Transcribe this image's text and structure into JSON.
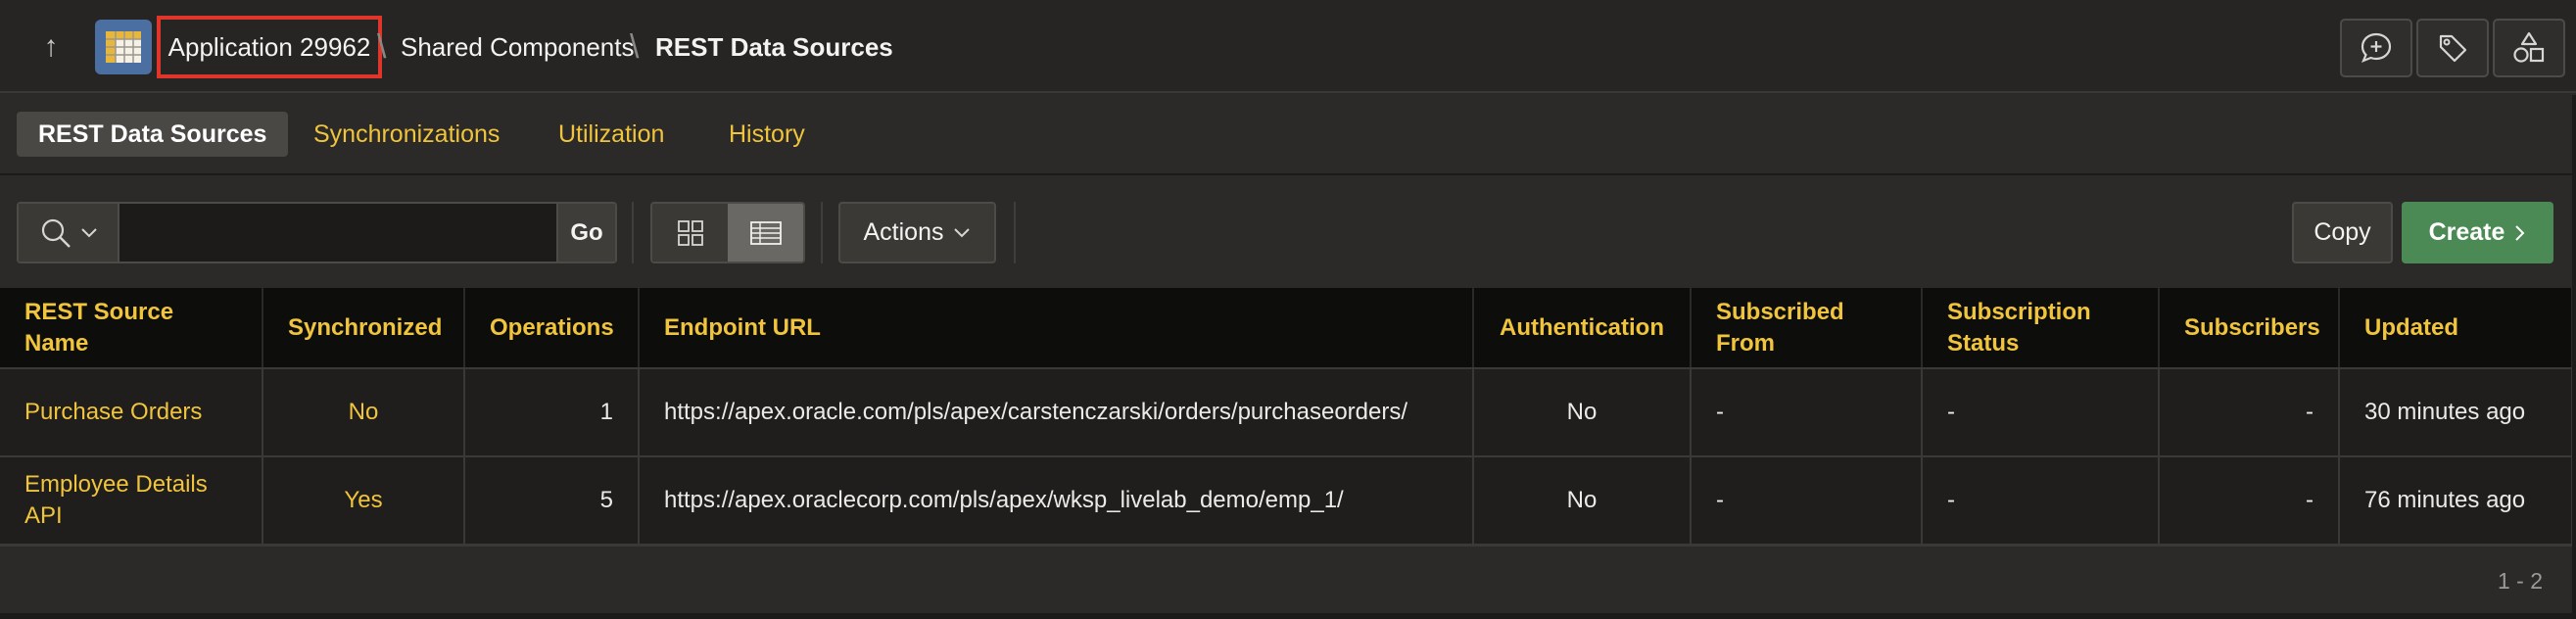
{
  "header": {
    "up_icon": "arrow-up-icon",
    "app_icon": "spreadsheet-grid-icon",
    "breadcrumb": {
      "app": "Application 29962",
      "shared": "Shared Components",
      "current": "REST Data Sources"
    },
    "buttons": [
      "comment-plus-icon",
      "tag-icon",
      "shapes-icon"
    ]
  },
  "tabs": [
    {
      "label": "REST Data Sources",
      "active": true
    },
    {
      "label": "Synchronizations",
      "active": false
    },
    {
      "label": "Utilization",
      "active": false
    },
    {
      "label": "History",
      "active": false
    }
  ],
  "toolbar": {
    "search_value": "",
    "go_label": "Go",
    "actions_label": "Actions",
    "copy_label": "Copy",
    "create_label": "Create"
  },
  "table": {
    "columns": [
      "REST Source Name",
      "Synchronized",
      "Operations",
      "Endpoint URL",
      "Authentication",
      "Subscribed From",
      "Subscription Status",
      "Subscribers",
      "Updated"
    ],
    "rows": [
      {
        "name": "Purchase Orders",
        "synchronized": "No",
        "operations": "1",
        "endpoint": "https://apex.oracle.com/pls/apex/carstenczarski/orders/purchaseorders/",
        "authentication": "No",
        "subscribed_from": "-",
        "subscription_status": "-",
        "subscribers": "-",
        "updated": "30 minutes ago"
      },
      {
        "name": "Employee Details API",
        "synchronized": "Yes",
        "operations": "5",
        "endpoint": "https://apex.oraclecorp.com/pls/apex/wksp_livelab_demo/emp_1/",
        "authentication": "No",
        "subscribed_from": "-",
        "subscription_status": "-",
        "subscribers": "-",
        "updated": "76 minutes ago"
      }
    ]
  },
  "pagination": "1 - 2",
  "colors": {
    "accent_yellow": "#f0c43c",
    "create_green": "#4c8a55",
    "highlight_red": "#e0352a"
  }
}
